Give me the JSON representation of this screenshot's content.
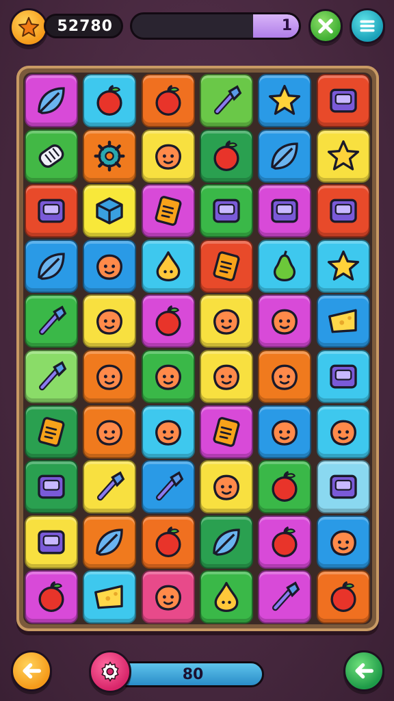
{
  "header": {
    "star_icon": "star-icon",
    "score": "52780",
    "progress_label": "1",
    "progress_fraction": 0.75,
    "close_icon": "close-icon",
    "menu_icon": "menu-icon"
  },
  "footer": {
    "back_icon": "arrow-left-icon",
    "settings_icon": "gear-icon",
    "counter": "80",
    "next_icon": "arrow-left-icon"
  },
  "board": {
    "rows": 10,
    "cols": 6,
    "tiles": [
      {
        "color": "#d84ad8",
        "icon": "leaf"
      },
      {
        "color": "#3ec8ee",
        "icon": "apple"
      },
      {
        "color": "#f07020",
        "icon": "apple"
      },
      {
        "color": "#6ac848",
        "icon": "brush"
      },
      {
        "color": "#2a9ae6",
        "icon": "star"
      },
      {
        "color": "#e84a2a",
        "icon": "box"
      },
      {
        "color": "#42b845",
        "icon": "roll"
      },
      {
        "color": "#f07a1e",
        "icon": "gear"
      },
      {
        "color": "#f8e040",
        "icon": "blob"
      },
      {
        "color": "#2aa050",
        "icon": "apple"
      },
      {
        "color": "#2a9ae6",
        "icon": "leaf"
      },
      {
        "color": "#f8e040",
        "icon": "star"
      },
      {
        "color": "#e84a2a",
        "icon": "box"
      },
      {
        "color": "#f8e83a",
        "icon": "cube"
      },
      {
        "color": "#d84ad8",
        "icon": "note"
      },
      {
        "color": "#3ab848",
        "icon": "box"
      },
      {
        "color": "#d84ad8",
        "icon": "box"
      },
      {
        "color": "#e84a2a",
        "icon": "box"
      },
      {
        "color": "#2a9ae6",
        "icon": "leaf"
      },
      {
        "color": "#2a9ae6",
        "icon": "blob"
      },
      {
        "color": "#3ec8ee",
        "icon": "drop"
      },
      {
        "color": "#e84a2a",
        "icon": "note"
      },
      {
        "color": "#3ec8ee",
        "icon": "pear"
      },
      {
        "color": "#3ec8ee",
        "icon": "star"
      },
      {
        "color": "#3ab848",
        "icon": "brush"
      },
      {
        "color": "#f8e040",
        "icon": "blob"
      },
      {
        "color": "#d84ad8",
        "icon": "apple"
      },
      {
        "color": "#f8e040",
        "icon": "blob"
      },
      {
        "color": "#d84ad8",
        "icon": "blob"
      },
      {
        "color": "#2a9ae6",
        "icon": "cheese"
      },
      {
        "color": "#8adc68",
        "icon": "brush"
      },
      {
        "color": "#f07a1e",
        "icon": "blob"
      },
      {
        "color": "#3ab848",
        "icon": "blob"
      },
      {
        "color": "#f8e040",
        "icon": "blob"
      },
      {
        "color": "#f07a1e",
        "icon": "blob"
      },
      {
        "color": "#3ec8ee",
        "icon": "box"
      },
      {
        "color": "#2aa050",
        "icon": "note"
      },
      {
        "color": "#f07a1e",
        "icon": "blob"
      },
      {
        "color": "#3ec8ee",
        "icon": "blob"
      },
      {
        "color": "#d84ad8",
        "icon": "note"
      },
      {
        "color": "#2a9ae6",
        "icon": "blob"
      },
      {
        "color": "#3ec8ee",
        "icon": "blob"
      },
      {
        "color": "#2aa050",
        "icon": "box"
      },
      {
        "color": "#f8e040",
        "icon": "brush"
      },
      {
        "color": "#2a9ae6",
        "icon": "brush"
      },
      {
        "color": "#f8e040",
        "icon": "blob"
      },
      {
        "color": "#3ab848",
        "icon": "apple"
      },
      {
        "color": "#8ad8f0",
        "icon": "box"
      },
      {
        "color": "#f8e040",
        "icon": "box"
      },
      {
        "color": "#f07a1e",
        "icon": "leaf"
      },
      {
        "color": "#f07020",
        "icon": "apple"
      },
      {
        "color": "#2aa050",
        "icon": "leaf"
      },
      {
        "color": "#d84ad8",
        "icon": "apple"
      },
      {
        "color": "#2a9ae6",
        "icon": "blob"
      },
      {
        "color": "#d84ad8",
        "icon": "apple"
      },
      {
        "color": "#3ec8ee",
        "icon": "cheese"
      },
      {
        "color": "#e84a8a",
        "icon": "blob"
      },
      {
        "color": "#3ab848",
        "icon": "drop"
      },
      {
        "color": "#d84ad8",
        "icon": "brush"
      },
      {
        "color": "#f07020",
        "icon": "apple"
      }
    ]
  }
}
